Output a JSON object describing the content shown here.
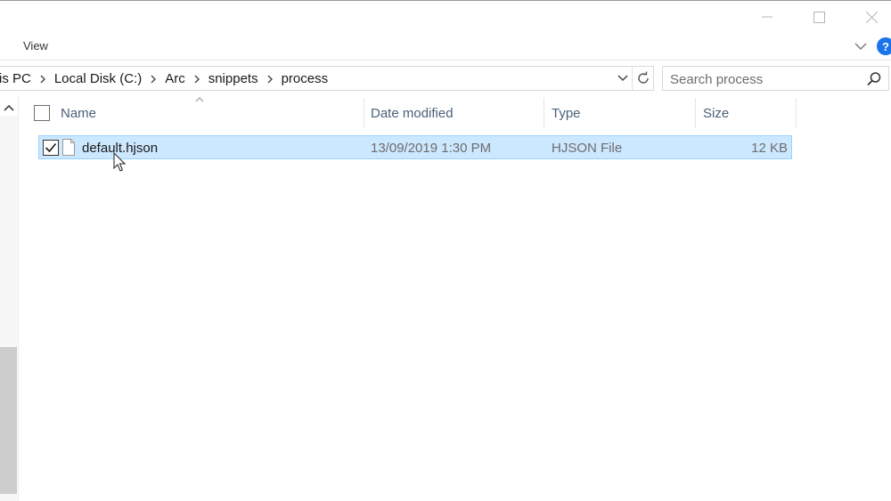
{
  "window": {
    "controls": [
      "minimize-icon",
      "maximize-icon",
      "close-icon"
    ]
  },
  "ribbon": {
    "tab_view": "View",
    "help_label": "?"
  },
  "address": {
    "crumbs": [
      "is PC",
      "Local Disk (C:)",
      "Arc",
      "snippets",
      "process"
    ]
  },
  "search": {
    "placeholder": "Search process"
  },
  "columns": {
    "name": "Name",
    "date": "Date modified",
    "type": "Type",
    "size": "Size"
  },
  "files": [
    {
      "name": "default.hjson",
      "date": "13/09/2019 1:30 PM",
      "type": "HJSON File",
      "size": "12 KB",
      "selected": true,
      "checked": true
    }
  ],
  "colors": {
    "selection_bg": "#cce8ff",
    "selection_border": "#99d1ff",
    "help_blue": "#1a73e8",
    "header_text": "#4c607a"
  }
}
